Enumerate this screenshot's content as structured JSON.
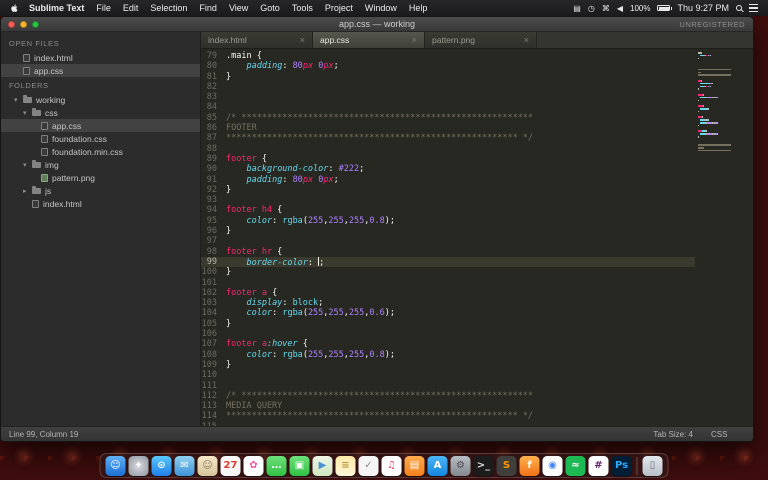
{
  "menu_bar": {
    "items": [
      "Sublime Text",
      "File",
      "Edit",
      "Selection",
      "Find",
      "View",
      "Goto",
      "Tools",
      "Project",
      "Window",
      "Help"
    ],
    "status_icons": [
      {
        "name": "display",
        "glyph": "▤"
      },
      {
        "name": "time-machine",
        "glyph": "◷"
      },
      {
        "name": "keyboard",
        "glyph": "⌘"
      },
      {
        "name": "volume",
        "glyph": "◀"
      }
    ],
    "battery_label": "100%",
    "clock": "Thu 9:27 PM"
  },
  "window": {
    "title": "app.css — working",
    "registration": "UNREGISTERED"
  },
  "sidebar": {
    "rows": [
      {
        "type": "header",
        "label": "OPEN FILES"
      },
      {
        "type": "file",
        "label": "index.html",
        "indent": 1
      },
      {
        "type": "file",
        "label": "app.css",
        "indent": 1,
        "selected": true
      },
      {
        "type": "header",
        "label": "FOLDERS"
      },
      {
        "type": "folder",
        "label": "working",
        "indent": 1,
        "expanded": true
      },
      {
        "type": "folder",
        "label": "css",
        "indent": 2,
        "expanded": true
      },
      {
        "type": "file",
        "label": "app.css",
        "indent": 3,
        "selected": true
      },
      {
        "type": "file",
        "label": "foundation.css",
        "indent": 3
      },
      {
        "type": "file",
        "label": "foundation.min.css",
        "indent": 3
      },
      {
        "type": "folder",
        "label": "img",
        "indent": 2,
        "expanded": true
      },
      {
        "type": "file",
        "label": "pattern.png",
        "indent": 3,
        "image": true
      },
      {
        "type": "folder",
        "label": "js",
        "indent": 2,
        "expanded": false
      },
      {
        "type": "file",
        "label": "index.html",
        "indent": 2
      }
    ]
  },
  "tab_bar": {
    "tabs": [
      {
        "label": "index.html",
        "active": false
      },
      {
        "label": "app.css",
        "active": true
      },
      {
        "label": "pattern.png",
        "active": false
      }
    ]
  },
  "editor": {
    "cursor_line": 99,
    "lines": [
      {
        "n": 79,
        "t": [
          [
            "sel",
            ".main"
          ],
          [
            "punct",
            " {"
          ]
        ]
      },
      {
        "n": 80,
        "t": [
          [
            "punct",
            "    "
          ],
          [
            "prop",
            "padding"
          ],
          [
            "punct",
            ": "
          ],
          [
            "num",
            "80"
          ],
          [
            "unit",
            "px"
          ],
          [
            "punct",
            " "
          ],
          [
            "num",
            "0"
          ],
          [
            "unit",
            "px"
          ],
          [
            "punct",
            ";"
          ]
        ]
      },
      {
        "n": 81,
        "t": [
          [
            "punct",
            "}"
          ]
        ]
      },
      {
        "n": 82,
        "t": []
      },
      {
        "n": 83,
        "t": []
      },
      {
        "n": 84,
        "t": []
      },
      {
        "n": 85,
        "t": [
          [
            "comment",
            "/* *********************************************************"
          ]
        ]
      },
      {
        "n": 86,
        "t": [
          [
            "comment",
            "FOOTER"
          ]
        ]
      },
      {
        "n": 87,
        "t": [
          [
            "comment",
            "********************************************************* */"
          ]
        ]
      },
      {
        "n": 88,
        "t": []
      },
      {
        "n": 89,
        "t": [
          [
            "elem",
            "footer"
          ],
          [
            "punct",
            " {"
          ]
        ]
      },
      {
        "n": 90,
        "t": [
          [
            "punct",
            "    "
          ],
          [
            "prop",
            "background-color"
          ],
          [
            "punct",
            ": "
          ],
          [
            "num",
            "#222"
          ],
          [
            "punct",
            ";"
          ]
        ]
      },
      {
        "n": 91,
        "t": [
          [
            "punct",
            "    "
          ],
          [
            "prop",
            "padding"
          ],
          [
            "punct",
            ": "
          ],
          [
            "num",
            "80"
          ],
          [
            "unit",
            "px"
          ],
          [
            "punct",
            " "
          ],
          [
            "num",
            "0"
          ],
          [
            "unit",
            "px"
          ],
          [
            "punct",
            ";"
          ]
        ]
      },
      {
        "n": 92,
        "t": [
          [
            "punct",
            "}"
          ]
        ]
      },
      {
        "n": 93,
        "t": []
      },
      {
        "n": 94,
        "t": [
          [
            "elem",
            "footer h4"
          ],
          [
            "punct",
            " {"
          ]
        ]
      },
      {
        "n": 95,
        "t": [
          [
            "punct",
            "    "
          ],
          [
            "prop",
            "color"
          ],
          [
            "punct",
            ": "
          ],
          [
            "func",
            "rgba"
          ],
          [
            "punct",
            "("
          ],
          [
            "num",
            "255"
          ],
          [
            "punct",
            ","
          ],
          [
            "num",
            "255"
          ],
          [
            "punct",
            ","
          ],
          [
            "num",
            "255"
          ],
          [
            "punct",
            ","
          ],
          [
            "num",
            "0.8"
          ],
          [
            "punct",
            ");"
          ]
        ]
      },
      {
        "n": 96,
        "t": [
          [
            "punct",
            "}"
          ]
        ]
      },
      {
        "n": 97,
        "t": []
      },
      {
        "n": 98,
        "t": [
          [
            "elem",
            "footer hr"
          ],
          [
            "punct",
            " {"
          ]
        ]
      },
      {
        "n": 99,
        "t": [
          [
            "punct",
            "    "
          ],
          [
            "prop",
            "border-color"
          ],
          [
            "punct",
            ": "
          ],
          [
            "caret",
            ""
          ],
          [
            "punct",
            ";"
          ]
        ]
      },
      {
        "n": 100,
        "t": [
          [
            "punct",
            "}"
          ]
        ]
      },
      {
        "n": 101,
        "t": []
      },
      {
        "n": 102,
        "t": [
          [
            "elem",
            "footer a"
          ],
          [
            "punct",
            " {"
          ]
        ]
      },
      {
        "n": 103,
        "t": [
          [
            "punct",
            "    "
          ],
          [
            "prop",
            "display"
          ],
          [
            "punct",
            ": "
          ],
          [
            "val",
            "block"
          ],
          [
            "punct",
            ";"
          ]
        ]
      },
      {
        "n": 104,
        "t": [
          [
            "punct",
            "    "
          ],
          [
            "prop",
            "color"
          ],
          [
            "punct",
            ": "
          ],
          [
            "func",
            "rgba"
          ],
          [
            "punct",
            "("
          ],
          [
            "num",
            "255"
          ],
          [
            "punct",
            ","
          ],
          [
            "num",
            "255"
          ],
          [
            "punct",
            ","
          ],
          [
            "num",
            "255"
          ],
          [
            "punct",
            ","
          ],
          [
            "num",
            "0.6"
          ],
          [
            "punct",
            ");"
          ]
        ]
      },
      {
        "n": 105,
        "t": [
          [
            "punct",
            "}"
          ]
        ]
      },
      {
        "n": 106,
        "t": []
      },
      {
        "n": 107,
        "t": [
          [
            "elem",
            "footer a"
          ],
          [
            "pseudo",
            ":hover"
          ],
          [
            "punct",
            " {"
          ]
        ]
      },
      {
        "n": 108,
        "t": [
          [
            "punct",
            "    "
          ],
          [
            "prop",
            "color"
          ],
          [
            "punct",
            ": "
          ],
          [
            "func",
            "rgba"
          ],
          [
            "punct",
            "("
          ],
          [
            "num",
            "255"
          ],
          [
            "punct",
            ","
          ],
          [
            "num",
            "255"
          ],
          [
            "punct",
            ","
          ],
          [
            "num",
            "255"
          ],
          [
            "punct",
            ","
          ],
          [
            "num",
            "0.8"
          ],
          [
            "punct",
            ");"
          ]
        ]
      },
      {
        "n": 109,
        "t": [
          [
            "punct",
            "}"
          ]
        ]
      },
      {
        "n": 110,
        "t": []
      },
      {
        "n": 111,
        "t": []
      },
      {
        "n": 112,
        "t": [
          [
            "comment",
            "/* *********************************************************"
          ]
        ]
      },
      {
        "n": 113,
        "t": [
          [
            "comment",
            "MEDIA QUERY"
          ]
        ]
      },
      {
        "n": 114,
        "t": [
          [
            "comment",
            "********************************************************* */"
          ]
        ]
      },
      {
        "n": 115,
        "t": []
      }
    ]
  },
  "status_bar": {
    "position": "Line 99, Column 19",
    "tab_size": "Tab Size: 4",
    "syntax": "CSS"
  },
  "dock": {
    "items": [
      {
        "name": "finder",
        "glyph": "☺",
        "bg": "linear-gradient(#5fb0f5,#1a6fd4)",
        "fg": "#ffffff"
      },
      {
        "name": "launchpad",
        "glyph": "✦",
        "bg": "radial-gradient(circle,#d9dde2,#8e949c)",
        "fg": "#ffffff"
      },
      {
        "name": "safari",
        "glyph": "⊙",
        "bg": "linear-gradient(#5ac8fa,#1f7fe8)",
        "fg": "#ffffff"
      },
      {
        "name": "mail",
        "glyph": "✉",
        "bg": "linear-gradient(#8fd0f0,#3f93d8)",
        "fg": "#ffffff"
      },
      {
        "name": "contacts",
        "glyph": "☺",
        "bg": "linear-gradient(#f5e7c8,#d8c49a)",
        "fg": "#8a7a55"
      },
      {
        "name": "calendar",
        "glyph": "27",
        "bg": "#f8f8f8",
        "fg": "#e23a2e"
      },
      {
        "name": "photos",
        "glyph": "✿",
        "bg": "#ffffff",
        "fg": "#e85aa0"
      },
      {
        "name": "messages",
        "glyph": "…",
        "bg": "linear-gradient(#6ee07a,#30c045)",
        "fg": "#ffffff"
      },
      {
        "name": "facetime",
        "glyph": "▣",
        "bg": "linear-gradient(#6ee07a,#30c045)",
        "fg": "#ffffff"
      },
      {
        "name": "maps",
        "glyph": "▶",
        "bg": "linear-gradient(#eef6e6,#cfe6c0)",
        "fg": "#4a90d9"
      },
      {
        "name": "notes",
        "glyph": "≡",
        "bg": "linear-gradient(#ffe9a8,#fdf6d8)",
        "fg": "#b89b4a"
      },
      {
        "name": "reminders",
        "glyph": "✓",
        "bg": "#f5f5f5",
        "fg": "#8a8a8a"
      },
      {
        "name": "itunes",
        "glyph": "♫",
        "bg": "#ffffff",
        "fg": "#f64072"
      },
      {
        "name": "ibooks",
        "glyph": "▤",
        "bg": "linear-gradient(#ffab4e,#f4801c)",
        "fg": "#ffffff"
      },
      {
        "name": "app-store",
        "glyph": "A",
        "bg": "linear-gradient(#4db5f7,#1386e0)",
        "fg": "#ffffff"
      },
      {
        "name": "system-preferences",
        "glyph": "⚙",
        "bg": "linear-gradient(#b8bdc4,#84898f)",
        "fg": "#4a4a4a"
      },
      {
        "name": "terminal",
        "glyph": ">_",
        "bg": "#1c1c1c",
        "fg": "#dddddd"
      },
      {
        "name": "sublime-text",
        "glyph": "S",
        "bg": "#413f3b",
        "fg": "#ff9800"
      },
      {
        "name": "firefox",
        "glyph": "f",
        "bg": "linear-gradient(#ffb14e,#f07316)",
        "fg": "#ffffff"
      },
      {
        "name": "chrome",
        "glyph": "◉",
        "bg": "#ffffff",
        "fg": "#4285f4"
      },
      {
        "name": "spotify",
        "glyph": "≈",
        "bg": "#1db954",
        "fg": "#ffffff"
      },
      {
        "name": "slack",
        "glyph": "#",
        "bg": "#ffffff",
        "fg": "#611f69"
      },
      {
        "name": "photoshop",
        "glyph": "Ps",
        "bg": "#001e36",
        "fg": "#31a8ff"
      },
      {
        "name": "trash",
        "glyph": "▯",
        "bg": "linear-gradient(#e3e8ed,#b8bfc6)",
        "fg": "#6e757c",
        "divider_before": true
      }
    ]
  }
}
